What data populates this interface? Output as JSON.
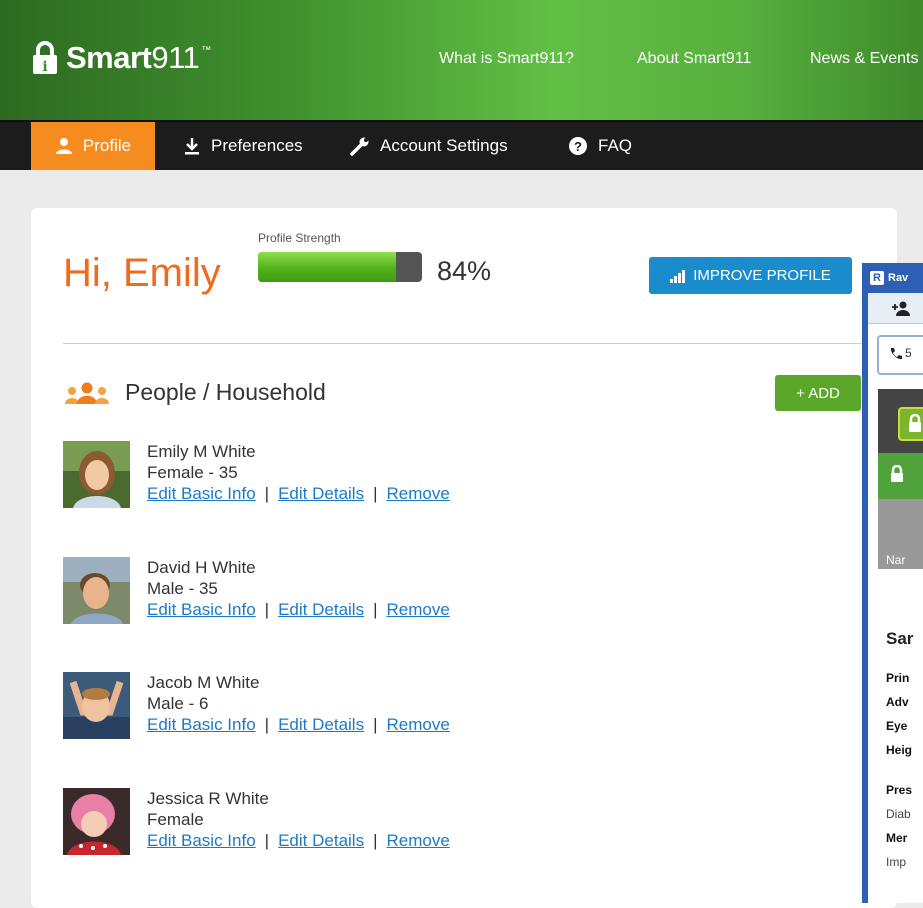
{
  "header": {
    "brand_bold": "Smart",
    "brand_light": "911",
    "brand_tm": "™",
    "nav": [
      "What is Smart911?",
      "About Smart911",
      "News & Events"
    ]
  },
  "subnav": {
    "items": [
      "Profile",
      "Preferences",
      "Account Settings",
      "FAQ"
    ],
    "active": "Profile"
  },
  "profile": {
    "greeting": "Hi, Emily",
    "strength_label": "Profile Strength",
    "strength_percent": 84,
    "strength_text": "84%",
    "improve_button": "IMPROVE PROFILE"
  },
  "household": {
    "title": "People / Household",
    "add_button": "+ ADD",
    "action_edit_basic": "Edit Basic Info",
    "action_edit_details": "Edit Details",
    "action_remove": "Remove",
    "separator": "|",
    "people": [
      {
        "name": "Emily M White",
        "detail": "Female - 35"
      },
      {
        "name": "David H White",
        "detail": "Male - 35"
      },
      {
        "name": "Jacob M White",
        "detail": "Male - 6"
      },
      {
        "name": "Jessica R White",
        "detail": "Female"
      }
    ]
  },
  "overlay": {
    "title": "Rav",
    "phone_text": "5",
    "name_label": "Nar",
    "person_name": "Sar",
    "field_labels": [
      "Prin",
      "Adv",
      "Eye",
      "Heig"
    ],
    "pres_label": "Pres",
    "pres_value": "Diab",
    "med_label": "Mer",
    "med_value": "Imp"
  },
  "colors": {
    "accent_orange": "#ef6c1f",
    "active_tab": "#f68b1f",
    "button_blue": "#1a8ccc",
    "button_green": "#5aa72a",
    "link": "#1b7ac7"
  }
}
